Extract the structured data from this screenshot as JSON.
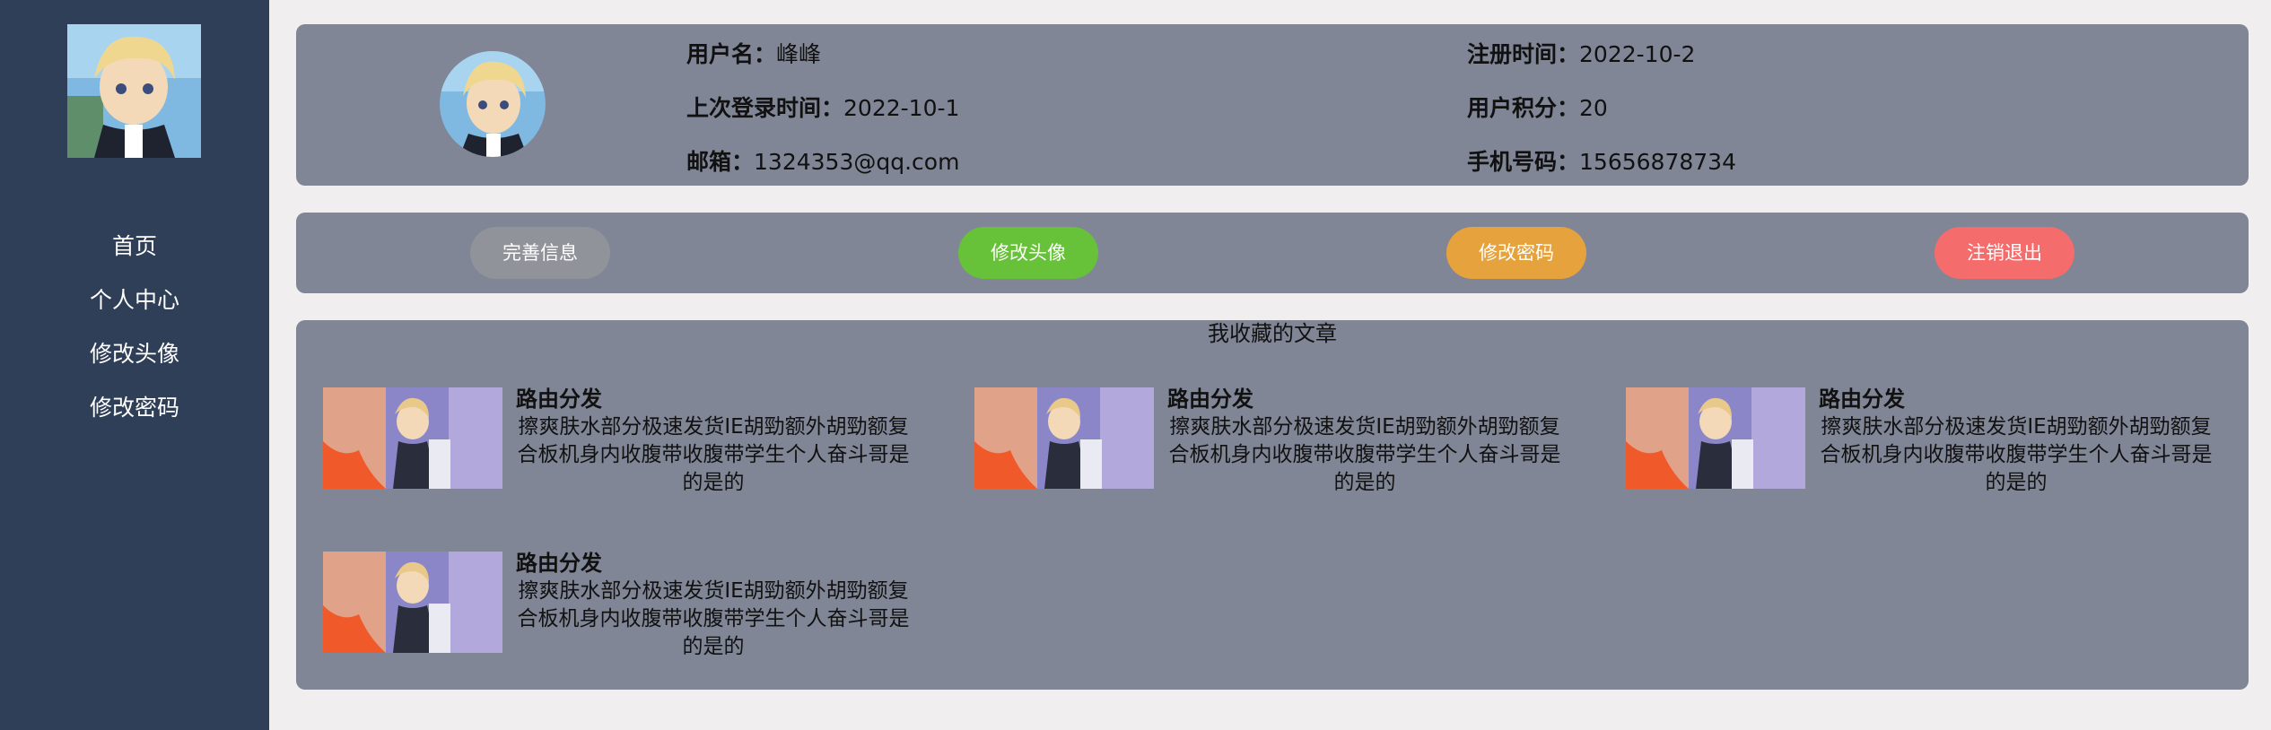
{
  "sidebar": {
    "nav": [
      "首页",
      "个人中心",
      "修改头像",
      "修改密码"
    ]
  },
  "profile": {
    "username_label": "用户名：",
    "username": "峰峰",
    "register_label": "注册时间：",
    "register_time": "2022-10-2",
    "last_login_label": "上次登录时间：",
    "last_login": "2022-10-1",
    "points_label": "用户积分：",
    "points": "20",
    "email_label": "邮箱：",
    "email": "1324353@qq.com",
    "phone_label": "手机号码：",
    "phone": "15656878734"
  },
  "actions": {
    "complete_info": "完善信息",
    "change_avatar": "修改头像",
    "change_password": "修改密码",
    "logout": "注销退出"
  },
  "colors": {
    "sidebar": "#2e3f57",
    "panel": "#808696",
    "btn_complete": "#909399",
    "btn_avatar": "#67c23a",
    "btn_password": "#e6a23c",
    "btn_logout": "#f56c6c"
  },
  "favorites": {
    "title": "我收藏的文章",
    "articles": [
      {
        "title": "路由分发",
        "desc": "擦爽肤水部分极速发货IE胡勁额外胡勁额复合板机身内收腹带收腹带学生个人奋斗哥是的是的"
      },
      {
        "title": "路由分发",
        "desc": "擦爽肤水部分极速发货IE胡勁额外胡勁额复合板机身内收腹带收腹带学生个人奋斗哥是的是的"
      },
      {
        "title": "路由分发",
        "desc": "擦爽肤水部分极速发货IE胡勁额外胡勁额复合板机身内收腹带收腹带学生个人奋斗哥是的是的"
      },
      {
        "title": "路由分发",
        "desc": "擦爽肤水部分极速发货IE胡勁额外胡勁额复合板机身内收腹带收腹带学生个人奋斗哥是的是的"
      }
    ]
  }
}
